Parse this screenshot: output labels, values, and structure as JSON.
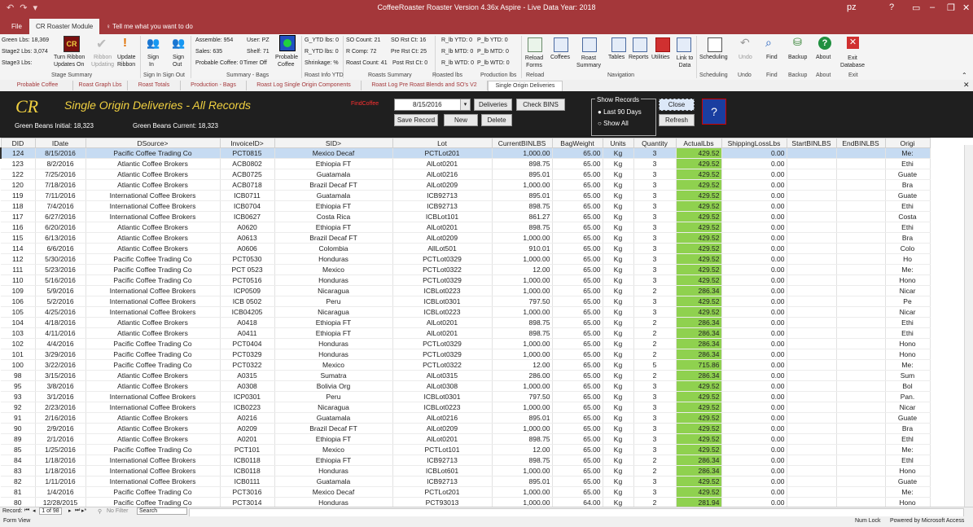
{
  "titlebar": {
    "title": "CoffeeRoaster Roaster Version 4.36x  Aspire   - Live Data   Year: 2018",
    "user": "pz",
    "help": "?"
  },
  "ribbon_tabs": [
    "File",
    "CR Roaster Module",
    "Tell me what you want to do"
  ],
  "ribbon": {
    "green_lbs": "Green Lbs: 18,369",
    "stage2_lbs": "Stage2 Lbs:   3,074",
    "stage3_lbs": "Stage3 Lbs:",
    "turn_ribbon": "Turn Ribbon",
    "updates_on": "Updates On",
    "ribbon_updates_label": "Ribbon",
    "updating": "Updating",
    "update": "Update",
    "ribbon2": "Ribbon",
    "sign_in": "Sign",
    "sign_in2": "In",
    "sign_out": "Sign",
    "sign_out2": "Out",
    "assemble": "Assemble: 954",
    "sales": "Sales:   635",
    "user": "User: PZ",
    "shelf": "Shelf: 71",
    "probable_coffee_label": "Probable Coffee: 0",
    "timer_off": "Timer Off",
    "probable": "Probable",
    "coffee": "Coffee",
    "g_ytd": "G_YTD lbs: 0",
    "r_ytd": "R_YTD lbs: 0",
    "shrinkage": "Shrinkage:  %",
    "so_count": "SO Count:   21",
    "so_rst": "SO Rst Ct:  16",
    "r_comp": "R Comp: 72",
    "pre_rst": "Pre Rst Ct:  25",
    "roast_count": "Roast Count: 41",
    "post_rst": "Post Rst Ct: 0",
    "rlb_ytd": "R_lb YTD: 0",
    "plb_ytd": "P_lb YTD: 0",
    "rlb_mtd": "R_lb MTD: 0",
    "plb_mtd": "P_lb MTD: 0",
    "rlb_wtd": "R_lb WTD: 0",
    "plb_wtd": "P_lb WTD: 0",
    "buttons": [
      "Reload Forms",
      "Coffees",
      "Roast Summary",
      "Tables",
      "Reports",
      "Utilities",
      "Link to Data",
      "Scheduling",
      "Undo",
      "Find",
      "Backup",
      "About",
      "Exit Database"
    ],
    "groups": [
      "Stage Summary",
      "Sign In  Sign Out",
      "Summary - Bags",
      "Roast Info YTD",
      "Roasts Summary",
      "Roasted lbs",
      "Production lbs",
      "Reload",
      "Navigation",
      "Scheduling",
      "Undo",
      "Find",
      "Backup",
      "About",
      "Exit"
    ]
  },
  "object_tabs": [
    "Probable Coffee",
    "Roast Graph Lbs",
    "Roast Totals",
    "Production - Bags",
    "Roast Log Single Origin Components",
    "Roast Log Pre Roast Blends and SO's V2",
    "Single Origin Deliveries"
  ],
  "form": {
    "logo": "CR",
    "title": "Single Origin Deliveries - All Records",
    "find_coffee_label": "FindCoffee",
    "find_date": "8/15/2016",
    "green_initial": "Green Beans Initial:  18,323",
    "green_current": "Green Beans Current:   18,323",
    "buttons": {
      "deliveries": "Deliveries",
      "check_bins": "Check BINS",
      "save": "Save Record",
      "new": "New",
      "delete": "Delete",
      "close": "Close",
      "refresh": "Refresh"
    },
    "show_records": "Show Records",
    "last90": "Last 90 Days",
    "show_all": "Show All"
  },
  "grid": {
    "columns": [
      "DID",
      "IDate",
      "DSource>",
      "InvoiceID>",
      "SID>",
      "Lot",
      "CurrentBINLBS",
      "BagWeight",
      "Units",
      "Quantity",
      "ActualLbs",
      "ShippingLossLbs",
      "StartBINLBS",
      "EndBINLBS",
      "Origi"
    ],
    "rows": [
      [
        "124",
        "8/15/2016",
        "Pacific Coffee Trading Co",
        "PCT0815",
        "Mexico Decaf",
        "PCTLot201",
        "1,000.00",
        "65.00",
        "Kg",
        "3",
        "429.52",
        "0.00",
        "",
        "",
        "Me:"
      ],
      [
        "123",
        "8/2/2016",
        "Atlantic Coffee Brokers",
        "ACB0802",
        "Ethiopia FT",
        "AlLot0201",
        "898.75",
        "65.00",
        "Kg",
        "3",
        "429.52",
        "0.00",
        "",
        "",
        "Ethi"
      ],
      [
        "122",
        "7/25/2016",
        "Atlantic Coffee Brokers",
        "ACB0725",
        "Guatamala",
        "AlLot0216",
        "895.01",
        "65.00",
        "Kg",
        "3",
        "429.52",
        "0.00",
        "",
        "",
        "Guate"
      ],
      [
        "120",
        "7/18/2016",
        "Atlantic Coffee Brokers",
        "ACB0718",
        "Brazil Decaf FT",
        "AlLot0209",
        "1,000.00",
        "65.00",
        "Kg",
        "3",
        "429.52",
        "0.00",
        "",
        "",
        "Bra"
      ],
      [
        "119",
        "7/11/2016",
        "International Coffee Brokers",
        "ICB0711",
        "Guatamala",
        "ICB92713",
        "895.01",
        "65.00",
        "Kg",
        "3",
        "429.52",
        "0.00",
        "",
        "",
        "Guate"
      ],
      [
        "118",
        "7/4/2016",
        "International Coffee Brokers",
        "ICB0704",
        "Ethiopia FT",
        "ICB92713",
        "898.75",
        "65.00",
        "Kg",
        "3",
        "429.52",
        "0.00",
        "",
        "",
        "Ethi"
      ],
      [
        "117",
        "6/27/2016",
        "International Coffee Brokers",
        "ICB0627",
        "Costa Rica",
        "ICBLot101",
        "861.27",
        "65.00",
        "Kg",
        "3",
        "429.52",
        "0.00",
        "",
        "",
        "Costa"
      ],
      [
        "116",
        "6/20/2016",
        "Atlantic Coffee Brokers",
        "A0620",
        "Ethiopia FT",
        "AlLot0201",
        "898.75",
        "65.00",
        "Kg",
        "3",
        "429.52",
        "0.00",
        "",
        "",
        "Ethi"
      ],
      [
        "115",
        "6/13/2016",
        "Atlantic Coffee Brokers",
        "A0613",
        "Brazil Decaf FT",
        "AlLot0209",
        "1,000.00",
        "65.00",
        "Kg",
        "3",
        "429.52",
        "0.00",
        "",
        "",
        "Bra"
      ],
      [
        "114",
        "6/6/2016",
        "Atlantic Coffee Brokers",
        "A0606",
        "Colombia",
        "AllLot501",
        "910.01",
        "65.00",
        "Kg",
        "3",
        "429.52",
        "0.00",
        "",
        "",
        "Colo"
      ],
      [
        "112",
        "5/30/2016",
        "Pacific Coffee Trading Co",
        "PCT0530",
        "Honduras",
        "PCTLot0329",
        "1,000.00",
        "65.00",
        "Kg",
        "3",
        "429.52",
        "0.00",
        "",
        "",
        "Ho"
      ],
      [
        "111",
        "5/23/2016",
        "Pacific Coffee Trading Co",
        "PCT 0523",
        "Mexico",
        "PCTLot0322",
        "12.00",
        "65.00",
        "Kg",
        "3",
        "429.52",
        "0.00",
        "",
        "",
        "Me:"
      ],
      [
        "110",
        "5/16/2016",
        "Pacific Coffee Trading Co",
        "PCT0516",
        "Honduras",
        "PCTLot0329",
        "1,000.00",
        "65.00",
        "Kg",
        "3",
        "429.52",
        "0.00",
        "",
        "",
        "Hono"
      ],
      [
        "109",
        "5/9/2016",
        "International Coffee Brokers",
        "ICP0509",
        "Nicaragua",
        "ICBLot0223",
        "1,000.00",
        "65.00",
        "Kg",
        "2",
        "286.34",
        "0.00",
        "",
        "",
        "Nicar"
      ],
      [
        "106",
        "5/2/2016",
        "International Coffee Brokers",
        "ICB 0502",
        "Peru",
        "ICBLot0301",
        "797.50",
        "65.00",
        "Kg",
        "3",
        "429.52",
        "0.00",
        "",
        "",
        "Pe"
      ],
      [
        "105",
        "4/25/2016",
        "International Coffee Brokers",
        "ICB04205",
        "Nicaragua",
        "ICBLot0223",
        "1,000.00",
        "65.00",
        "Kg",
        "3",
        "429.52",
        "0.00",
        "",
        "",
        "Nicar"
      ],
      [
        "104",
        "4/18/2016",
        "Atlantic Coffee Brokers",
        "A0418",
        "Ethiopia FT",
        "AlLot0201",
        "898.75",
        "65.00",
        "Kg",
        "2",
        "286.34",
        "0.00",
        "",
        "",
        "Ethi"
      ],
      [
        "103",
        "4/11/2016",
        "Atlantic Coffee Brokers",
        "A0411",
        "Ethiopia FT",
        "AlLot0201",
        "898.75",
        "65.00",
        "Kg",
        "2",
        "286.34",
        "0.00",
        "",
        "",
        "Ethi"
      ],
      [
        "102",
        "4/4/2016",
        "Pacific Coffee Trading Co",
        "PCT0404",
        "Honduras",
        "PCTLot0329",
        "1,000.00",
        "65.00",
        "Kg",
        "2",
        "286.34",
        "0.00",
        "",
        "",
        "Hono"
      ],
      [
        "101",
        "3/29/2016",
        "Pacific Coffee Trading Co",
        "PCT0329",
        "Honduras",
        "PCTLot0329",
        "1,000.00",
        "65.00",
        "Kg",
        "2",
        "286.34",
        "0.00",
        "",
        "",
        "Hono"
      ],
      [
        "100",
        "3/22/2016",
        "Pacific Coffee Trading Co",
        "PCT0322",
        "Mexico",
        "PCTLot0322",
        "12.00",
        "65.00",
        "Kg",
        "5",
        "715.86",
        "0.00",
        "",
        "",
        "Me:"
      ],
      [
        "98",
        "3/15/2016",
        "Atlantic Coffee Brokers",
        "A0315",
        "Sumatra",
        "AlLot0315",
        "286.00",
        "65.00",
        "Kg",
        "2",
        "286.34",
        "0.00",
        "",
        "",
        "Sum"
      ],
      [
        "95",
        "3/8/2016",
        "Atlantic Coffee Brokers",
        "A0308",
        "Bolivia Org",
        "AlLot0308",
        "1,000.00",
        "65.00",
        "Kg",
        "3",
        "429.52",
        "0.00",
        "",
        "",
        "Bol"
      ],
      [
        "93",
        "3/1/2016",
        "International Coffee Brokers",
        "ICP0301",
        "Peru",
        "ICBLot0301",
        "797.50",
        "65.00",
        "Kg",
        "3",
        "429.52",
        "0.00",
        "",
        "",
        "Pan."
      ],
      [
        "92",
        "2/23/2016",
        "International Coffee Brokers",
        "ICB0223",
        "Nicaragua",
        "ICBLot0223",
        "1,000.00",
        "65.00",
        "Kg",
        "3",
        "429.52",
        "0.00",
        "",
        "",
        "Nicar"
      ],
      [
        "91",
        "2/16/2016",
        "Atlantic Coffee Brokers",
        "A0216",
        "Guatamala",
        "AlLot0216",
        "895.01",
        "65.00",
        "Kg",
        "3",
        "429.52",
        "0.00",
        "",
        "",
        "Guate"
      ],
      [
        "90",
        "2/9/2016",
        "Atlantic Coffee Brokers",
        "A0209",
        "Brazil Decaf FT",
        "AlLot0209",
        "1,000.00",
        "65.00",
        "Kg",
        "3",
        "429.52",
        "0.00",
        "",
        "",
        "Bra"
      ],
      [
        "89",
        "2/1/2016",
        "Atlantic Coffee Brokers",
        "A0201",
        "Ethiopia FT",
        "AlLot0201",
        "898.75",
        "65.00",
        "Kg",
        "3",
        "429.52",
        "0.00",
        "",
        "",
        "Ethl"
      ],
      [
        "85",
        "1/25/2016",
        "Pacific Coffee Trading Co",
        "PCT101",
        "Mexico",
        "PCTLot101",
        "12.00",
        "65.00",
        "Kg",
        "3",
        "429.52",
        "0.00",
        "",
        "",
        "Me:"
      ],
      [
        "84",
        "1/18/2016",
        "International Coffee Brokers",
        "ICB0118",
        "Ethiopia FT",
        "ICB92713",
        "898.75",
        "65.00",
        "Kg",
        "2",
        "286.34",
        "0.00",
        "",
        "",
        "Ethl"
      ],
      [
        "83",
        "1/18/2016",
        "International Coffee Brokers",
        "ICB0118",
        "Honduras",
        "ICBLot601",
        "1,000.00",
        "65.00",
        "Kg",
        "2",
        "286.34",
        "0.00",
        "",
        "",
        "Hono"
      ],
      [
        "82",
        "1/11/2016",
        "International Coffee Brokers",
        "ICB0111",
        "Guatamala",
        "ICB92713",
        "895.01",
        "65.00",
        "Kg",
        "3",
        "429.52",
        "0.00",
        "",
        "",
        "Guate"
      ],
      [
        "81",
        "1/4/2016",
        "Pacific Coffee Trading Co",
        "PCT3016",
        "Mexico Decaf",
        "PCTLot201",
        "1,000.00",
        "65.00",
        "Kg",
        "3",
        "429.52",
        "0.00",
        "",
        "",
        "Me:"
      ],
      [
        "80",
        "12/28/2015",
        "Pacific Coffee Trading Co",
        "PCT3014",
        "Honduras",
        "PCT93013",
        "1,000.00",
        "64.00",
        "Kg",
        "2",
        "281.94",
        "0.00",
        "",
        "",
        "Hono"
      ]
    ]
  },
  "navbar": {
    "record_label": "Record:",
    "position": "1 of 98",
    "no_filter": "No Filter",
    "search": "Search"
  },
  "status": {
    "left": "Form View",
    "numlock": "Num Lock",
    "powered": "Powered by Microsoft Access"
  }
}
